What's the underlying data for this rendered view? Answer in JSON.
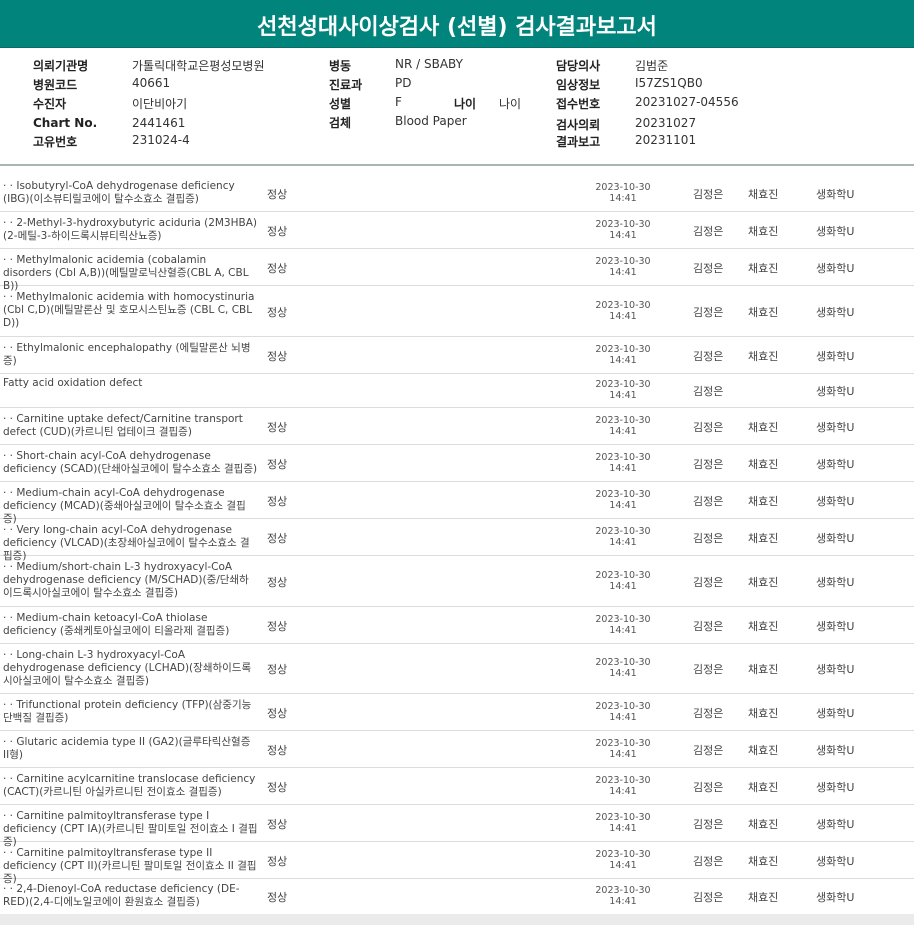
{
  "report": {
    "title": "선천성대사이상검사 (선별) 검사결과보고서"
  },
  "patient": {
    "left": [
      {
        "label": "의뢰기관명",
        "value": "가톨릭대학교은평성모병원"
      },
      {
        "label": "병원코드",
        "value": "40661"
      },
      {
        "label": "수진자",
        "value": "이단비아기"
      },
      {
        "label": "Chart No.",
        "value": "2441461"
      },
      {
        "label": "고유번호",
        "value": "231024-4"
      }
    ],
    "middle": [
      {
        "label": "병동",
        "value": "NR / SBABY"
      },
      {
        "label": "진료과",
        "value": "PD"
      },
      {
        "label": "성별",
        "value": "F"
      },
      {
        "label": "검체",
        "value": "Blood Paper"
      }
    ],
    "age_label": "나이",
    "age_value": "나이",
    "right": [
      {
        "label": "담당의사",
        "value": "김범준"
      },
      {
        "label": "임상정보",
        "value": "I57ZS1QB0"
      },
      {
        "label": "접수번호",
        "value": "20231027-04556"
      },
      {
        "label": "검사의뢰",
        "value": "20231027"
      },
      {
        "label": "결과보고",
        "value": "20231101"
      }
    ]
  },
  "results": [
    {
      "name": "  · · Isobutyryl-CoA dehydrogenase deficiency (IBG)(이소뷰티릴코에이 탈수소효소 결핍증)",
      "result": "정상",
      "date": "2023-10-30",
      "time": "14:41",
      "tester": "김정은",
      "approver": "채효진",
      "dept": "생화학U"
    },
    {
      "name": "  · · 2-Methyl-3-hydroxybutyric aciduria (2M3HBA)(2-메틸-3-하이드록시뷰티릭산뇨증)",
      "result": "정상",
      "date": "2023-10-30",
      "time": "14:41",
      "tester": "김정은",
      "approver": "채효진",
      "dept": "생화학U"
    },
    {
      "name": "  · · Methylmalonic acidemia (cobalamin disorders (Cbl A,B))(메틸말로닉산혈증(CBL A, CBL B))",
      "result": "정상",
      "date": "2023-10-30",
      "time": "14:41",
      "tester": "김정은",
      "approver": "채효진",
      "dept": "생화학U"
    },
    {
      "name": "  · · Methylmalonic acidemia with homocystinuria (Cbl C,D)(메틸말론산 및 호모시스틴뇨증 (CBL C, CBL D))",
      "result": "정상",
      "date": "2023-10-30",
      "time": "14:41",
      "tester": "김정은",
      "approver": "채효진",
      "dept": "생화학U"
    },
    {
      "name": "  · · Ethylmalonic encephalopathy (에틸말론산 뇌병증)",
      "result": "정상",
      "date": "2023-10-30",
      "time": "14:41",
      "tester": "김정은",
      "approver": "채효진",
      "dept": "생화학U"
    },
    {
      "name": "   Fatty acid oxidation defect",
      "result": "",
      "date": "2023-10-30",
      "time": "14:41",
      "tester": "김정은",
      "approver": "",
      "dept": "생화학U"
    },
    {
      "name": "  · · Carnitine uptake defect/Carnitine transport defect (CUD)(카르니틴 업테이크 결핍증)",
      "result": "정상",
      "date": "2023-10-30",
      "time": "14:41",
      "tester": "김정은",
      "approver": "채효진",
      "dept": "생화학U"
    },
    {
      "name": "  · · Short-chain acyl-CoA dehydrogenase deficiency (SCAD)(단쇄아실코에이 탈수소효소 결핍증)",
      "result": "정상",
      "date": "2023-10-30",
      "time": "14:41",
      "tester": "김정은",
      "approver": "채효진",
      "dept": "생화학U"
    },
    {
      "name": "  · · Medium-chain acyl-CoA dehydrogenase deficiency (MCAD)(중쇄아실코에이 탈수소효소 결핍증)",
      "result": "정상",
      "date": "2023-10-30",
      "time": "14:41",
      "tester": "김정은",
      "approver": "채효진",
      "dept": "생화학U"
    },
    {
      "name": "  · · Very long-chain acyl-CoA dehydrogenase deficiency (VLCAD)(초장쇄아실코에이 탈수소효소 결핍증)",
      "result": "정상",
      "date": "2023-10-30",
      "time": "14:41",
      "tester": "김정은",
      "approver": "채효진",
      "dept": "생화학U"
    },
    {
      "name": "  · · Medium/short-chain L-3 hydroxyacyl-CoA dehydrogenase deficiency (M/SCHAD)(중/단쇄하이드록시아실코에이 탈수소효소 결핍증)",
      "result": "정상",
      "date": "2023-10-30",
      "time": "14:41",
      "tester": "김정은",
      "approver": "채효진",
      "dept": "생화학U"
    },
    {
      "name": "  · · Medium-chain ketoacyl-CoA thiolase deficiency (중쇄케토아실코에이 티올라제 결핍증)",
      "result": "정상",
      "date": "2023-10-30",
      "time": "14:41",
      "tester": "김정은",
      "approver": "채효진",
      "dept": "생화학U"
    },
    {
      "name": "  · · Long-chain L-3 hydroxyacyl-CoA dehydrogenase deficiency (LCHAD)(장쇄하이드록시아실코에이 탈수소효소 결핍증)",
      "result": "정상",
      "date": "2023-10-30",
      "time": "14:41",
      "tester": "김정은",
      "approver": "채효진",
      "dept": "생화학U"
    },
    {
      "name": "  · · Trifunctional protein deficiency (TFP)(삼중기능단백질 결핍증)",
      "result": "정상",
      "date": "2023-10-30",
      "time": "14:41",
      "tester": "김정은",
      "approver": "채효진",
      "dept": "생화학U"
    },
    {
      "name": "  · · Glutaric acidemia type II (GA2)(글루타릭산혈증 II형)",
      "result": "정상",
      "date": "2023-10-30",
      "time": "14:41",
      "tester": "김정은",
      "approver": "채효진",
      "dept": "생화학U"
    },
    {
      "name": "  · · Carnitine acylcarnitine translocase deficiency (CACT)(카르니틴 아실카르니틴 전이효소 결핍증)",
      "result": "정상",
      "date": "2023-10-30",
      "time": "14:41",
      "tester": "김정은",
      "approver": "채효진",
      "dept": "생화학U"
    },
    {
      "name": "  · · Carnitine palmitoyltransferase type I deficiency (CPT IA)(카르니틴 팔미토일 전이효소 I 결핍증)",
      "result": "정상",
      "date": "2023-10-30",
      "time": "14:41",
      "tester": "김정은",
      "approver": "채효진",
      "dept": "생화학U"
    },
    {
      "name": "  · · Carnitine palmitoyltransferase type II deficiency (CPT II)(카르니틴 팔미토일 전이효소 II 결핍증)",
      "result": "정상",
      "date": "2023-10-30",
      "time": "14:41",
      "tester": "김정은",
      "approver": "채효진",
      "dept": "생화학U"
    },
    {
      "name": "  · · 2,4-Dienoyl-CoA reductase deficiency (DE-RED)(2,4-디에노일코에이 환원효소 결핍증)",
      "result": "정상",
      "date": "2023-10-30",
      "time": "14:41",
      "tester": "김정은",
      "approver": "채효진",
      "dept": "생화학U"
    }
  ]
}
